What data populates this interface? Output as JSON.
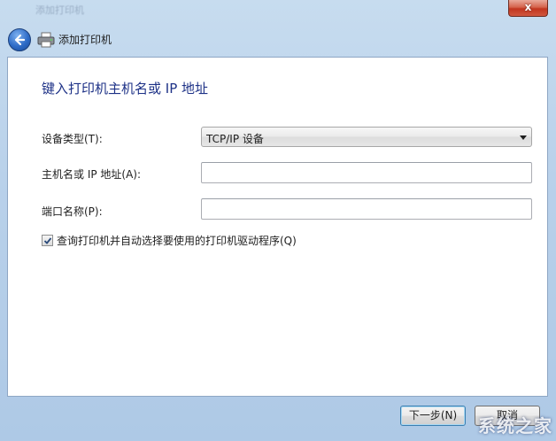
{
  "window": {
    "background_title": "添加打印机",
    "close_glyph": "x",
    "accent": "#1e3287"
  },
  "nav": {
    "back_icon": "back-arrow-icon",
    "printer_icon": "printer-icon",
    "title": "添加打印机"
  },
  "form": {
    "heading": "键入打印机主机名或 IP 地址",
    "device_type_label": "设备类型(T):",
    "device_type_value": "TCP/IP 设备",
    "hostname_label": "主机名或 IP 地址(A):",
    "hostname_value": "",
    "port_label": "端口名称(P):",
    "port_value": "",
    "auto_driver_label": "查询打印机并自动选择要使用的打印机驱动程序(Q)",
    "auto_driver_checked": true
  },
  "footer": {
    "next_label": "下一步(N)",
    "cancel_label": "取消"
  },
  "watermark": "系统之家"
}
